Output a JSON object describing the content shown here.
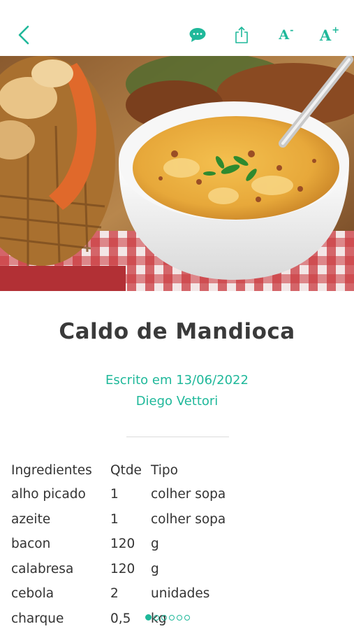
{
  "toolbar": {
    "font_decrease_label": "A",
    "font_decrease_sup": "-",
    "font_increase_label": "A",
    "font_increase_sup": "+"
  },
  "recipe": {
    "title": "Caldo de Mandioca",
    "written_on": "Escrito em 13/06/2022",
    "author": "Diego Vettori"
  },
  "ingredients": {
    "headers": [
      "Ingredientes",
      "Qtde",
      "Tipo"
    ],
    "rows": [
      [
        "alho picado",
        "1",
        "colher sopa"
      ],
      [
        "azeite",
        "1",
        "colher sopa"
      ],
      [
        "bacon",
        "120",
        "g"
      ],
      [
        "calabresa",
        "120",
        "g"
      ],
      [
        "cebola",
        "2",
        "unidades"
      ],
      [
        "charque",
        "0,5",
        "kg"
      ]
    ]
  },
  "pager": {
    "total": 6,
    "active": 0
  },
  "colors": {
    "accent": "#1fb89a",
    "text": "#333333"
  }
}
